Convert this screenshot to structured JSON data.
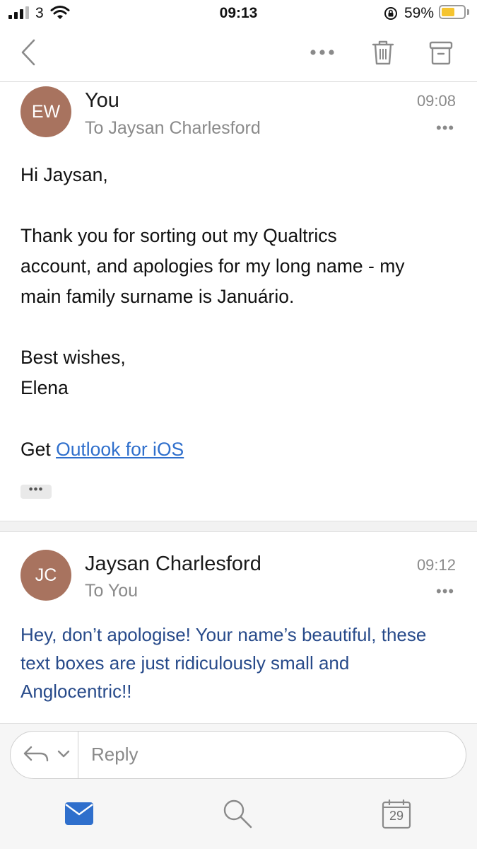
{
  "status_bar": {
    "carrier": "3",
    "time": "09:13",
    "battery_percent": "59%",
    "battery_level": 0.59,
    "icons": [
      "signal-icon",
      "wifi-icon",
      "rotation-lock-icon",
      "battery-icon"
    ]
  },
  "toolbar": {
    "icons": [
      "back-icon",
      "more-icon",
      "trash-icon",
      "archive-icon"
    ]
  },
  "messages": [
    {
      "avatar_initials": "EW",
      "avatar_color": "#a8735f",
      "sender": "You",
      "recipient": "To Jaysan Charlesford",
      "time": "09:08",
      "greeting": "Hi Jaysan,",
      "paragraph": "Thank you for sorting out my Qualtrics\naccount, and apologies for my long name - my\nmain family surname is Januário.",
      "signoff": "Best wishes,\nElena",
      "footer_prefix": "Get ",
      "footer_link": "Outlook for iOS",
      "collapsed_indicator": "•••"
    },
    {
      "avatar_initials": "JC",
      "avatar_color": "#a8735f",
      "sender": "Jaysan Charlesford",
      "recipient": "To You",
      "time": "09:12",
      "body": "Hey, don’t apologise! Your name’s beautiful, these\ntext boxes are just ridiculously small and\nAnglocentric!!"
    }
  ],
  "reply": {
    "placeholder": "Reply"
  },
  "tab_bar": {
    "tabs": [
      {
        "name": "mail",
        "icon": "mail-icon",
        "active": true
      },
      {
        "name": "search",
        "icon": "search-icon",
        "active": false
      },
      {
        "name": "calendar",
        "icon": "calendar-icon",
        "date": "29",
        "active": false
      }
    ]
  },
  "colors": {
    "accent": "#2f6fcc",
    "reply_text": "#274a8a",
    "battery": "#f5c430"
  }
}
